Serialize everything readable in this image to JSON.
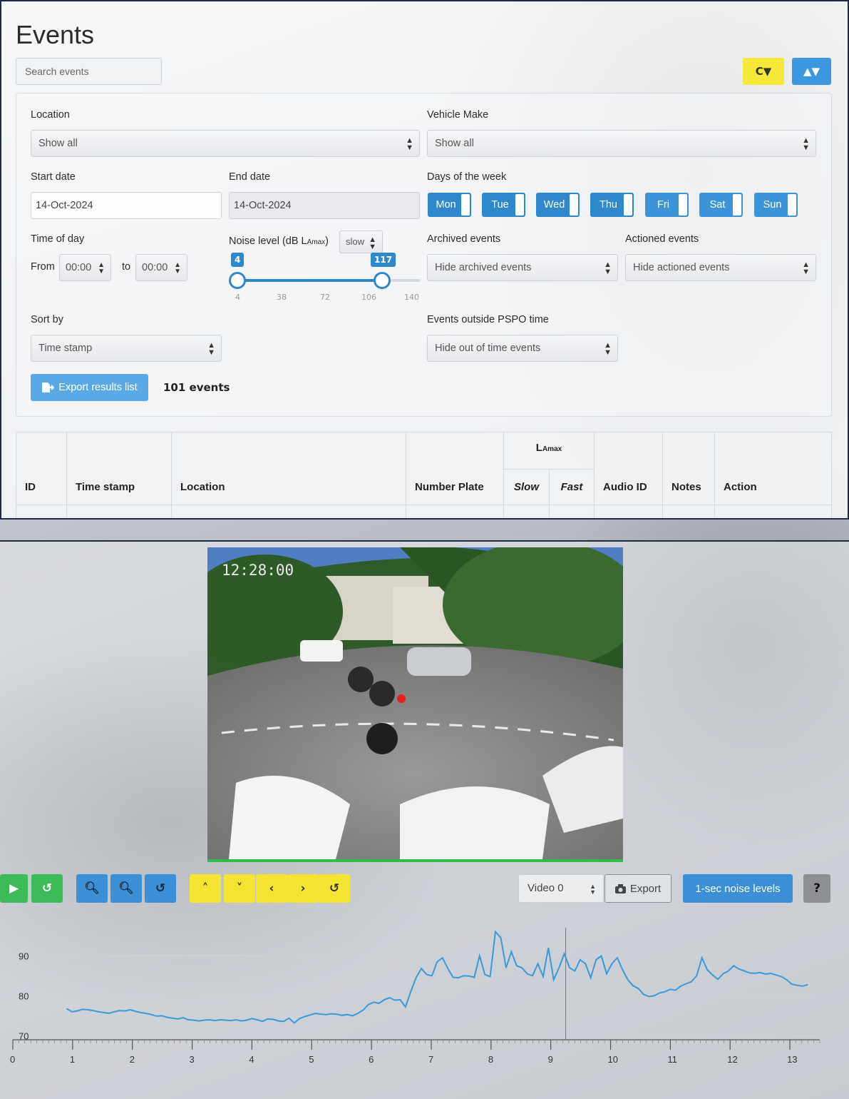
{
  "header": {
    "title": "Events",
    "search_placeholder": "Search events",
    "reset_filter_icon": "C▼",
    "toggle_filter_icon": "▲▼"
  },
  "filters": {
    "location_label": "Location",
    "location_value": "Show all",
    "vehicle_make_label": "Vehicle Make",
    "vehicle_make_value": "Show all",
    "start_date_label": "Start date",
    "start_date_value": "14-Oct-2024",
    "end_date_label": "End date",
    "end_date_value": "14-Oct-2024",
    "days_label": "Days of the week",
    "days": [
      "Mon",
      "Tue",
      "Wed",
      "Thu",
      "Fri",
      "Sat",
      "Sun"
    ],
    "time_of_day_label": "Time of day",
    "from_label": "From",
    "from_value": "00:00",
    "to_label": "to",
    "to_value": "00:00",
    "noise_label": "Noise level (dB L",
    "noise_label_sub": "Amax",
    "noise_label_end": ")",
    "noise_speed": "slow",
    "noise_min_selected": "4",
    "noise_max_selected": "117",
    "noise_ticks": [
      "4",
      "38",
      "72",
      "106",
      "140"
    ],
    "noise_range": {
      "min": 4,
      "max": 140,
      "low": 4,
      "high": 117
    },
    "archived_label": "Archived events",
    "archived_value": "Hide archived events",
    "actioned_label": "Actioned events",
    "actioned_value": "Hide actioned events",
    "sort_label": "Sort by",
    "sort_value": "Time stamp",
    "pspo_label": "Events outside PSPO time",
    "pspo_value": "Hide out of time events",
    "export_label": "Export results list",
    "count": "101 events"
  },
  "table": {
    "headers": {
      "id": "ID",
      "timestamp": "Time stamp",
      "location": "Location",
      "plate": "Number Plate",
      "lamax": "L",
      "lamax_sub": "Amax",
      "slow": "Slow",
      "fast": "Fast",
      "audio": "Audio ID",
      "notes": "Notes",
      "action": "Action"
    }
  },
  "player": {
    "video_timestamp": "12:28:00",
    "video_select": "Video 0",
    "export_label": "Export",
    "noise_levels_label": "1-sec noise levels",
    "help_label": "?"
  },
  "chart_data": {
    "type": "line",
    "xlim": [
      0,
      13.5
    ],
    "ylim": [
      69,
      97
    ],
    "yticks": [
      70,
      80,
      90
    ],
    "xticks": [
      0,
      1,
      2,
      3,
      4,
      5,
      6,
      7,
      8,
      9,
      10,
      11,
      12,
      13
    ],
    "cursor_x": 9.25,
    "color": "#3a9ad9",
    "x": [
      0.9,
      1.0,
      1.1,
      1.2,
      1.3,
      1.4,
      1.5,
      1.6,
      1.7,
      1.8,
      1.9,
      2.0,
      2.1,
      2.2,
      2.3,
      2.4,
      2.5,
      2.6,
      2.7,
      2.8,
      2.9,
      3.0,
      3.1,
      3.2,
      3.3,
      3.4,
      3.5,
      3.6,
      3.7,
      3.8,
      3.9,
      4.0,
      4.1,
      4.2,
      4.3,
      4.4,
      4.5,
      4.6,
      4.7,
      4.8,
      4.9,
      5.0,
      5.1,
      5.2,
      5.3,
      5.4,
      5.5,
      5.6,
      5.7,
      5.8,
      5.9,
      6.0,
      6.1,
      6.2,
      6.3,
      6.4,
      6.5,
      6.6,
      6.7,
      6.8,
      6.9,
      7.0,
      7.1,
      7.2,
      7.3,
      7.4,
      7.5,
      7.6,
      7.7,
      7.8,
      7.9,
      8.0,
      8.1,
      8.2,
      8.3,
      8.4,
      8.5,
      8.6,
      8.7,
      8.8,
      8.9,
      9.0,
      9.1,
      9.2,
      9.3,
      9.4,
      9.5,
      9.6,
      9.7,
      9.8,
      9.9,
      10.0,
      10.1,
      10.2,
      10.3,
      10.4,
      10.5,
      10.6,
      10.7,
      10.8,
      10.9,
      11.0,
      11.1,
      11.2,
      11.3,
      11.4,
      11.5,
      11.6,
      11.7,
      11.8,
      11.9,
      12.0,
      12.1,
      12.2,
      12.3,
      12.4,
      12.5,
      12.6,
      12.7,
      12.8,
      12.9,
      13.0,
      13.1,
      13.2,
      13.3,
      13.4
    ],
    "y": [
      76.8,
      76.0,
      76.2,
      76.6,
      76.5,
      76.3,
      76.0,
      75.8,
      75.6,
      76.0,
      76.3,
      76.2,
      76.5,
      76.1,
      75.8,
      75.6,
      75.3,
      74.9,
      75.0,
      74.6,
      74.4,
      74.2,
      74.5,
      74.0,
      73.9,
      73.7,
      73.9,
      74.0,
      73.8,
      74.0,
      73.9,
      73.8,
      74.0,
      73.7,
      73.9,
      74.3,
      74.0,
      73.6,
      74.2,
      74.1,
      73.7,
      73.6,
      74.4,
      73.2,
      74.3,
      74.8,
      75.2,
      75.6,
      75.4,
      75.3,
      75.5,
      75.4,
      75.1,
      75.3,
      75.0,
      75.6,
      76.4,
      77.8,
      78.4,
      78.1,
      79.0,
      79.5,
      78.9,
      79.0,
      77.2,
      81.0,
      84.5,
      86.8,
      85.3,
      85.0,
      88.5,
      89.5,
      86.8,
      84.6,
      84.5,
      85.0,
      84.9,
      84.6,
      90.0,
      85.3,
      84.8,
      96.0,
      94.5,
      87.0,
      91.0,
      87.5,
      87.0,
      85.5,
      85.0,
      88.0,
      84.8,
      92.0,
      84.0,
      87.0,
      90.5,
      87.0,
      86.2,
      89.0,
      88.0,
      84.5,
      89.0,
      90.0,
      85.5,
      88.0,
      89.5,
      86.5,
      84.0,
      82.5,
      81.8,
      80.3,
      79.8,
      80.0,
      80.7,
      81.0,
      81.6,
      81.4,
      82.4,
      83.0,
      83.5,
      85.0,
      89.5,
      86.5,
      85.2,
      84.1,
      85.5,
      86.2,
      87.5,
      86.7,
      86.2,
      85.7,
      85.6,
      85.8,
      85.4,
      85.6,
      85.2,
      84.8,
      84.0,
      82.9,
      82.6,
      82.4,
      82.8
    ]
  }
}
